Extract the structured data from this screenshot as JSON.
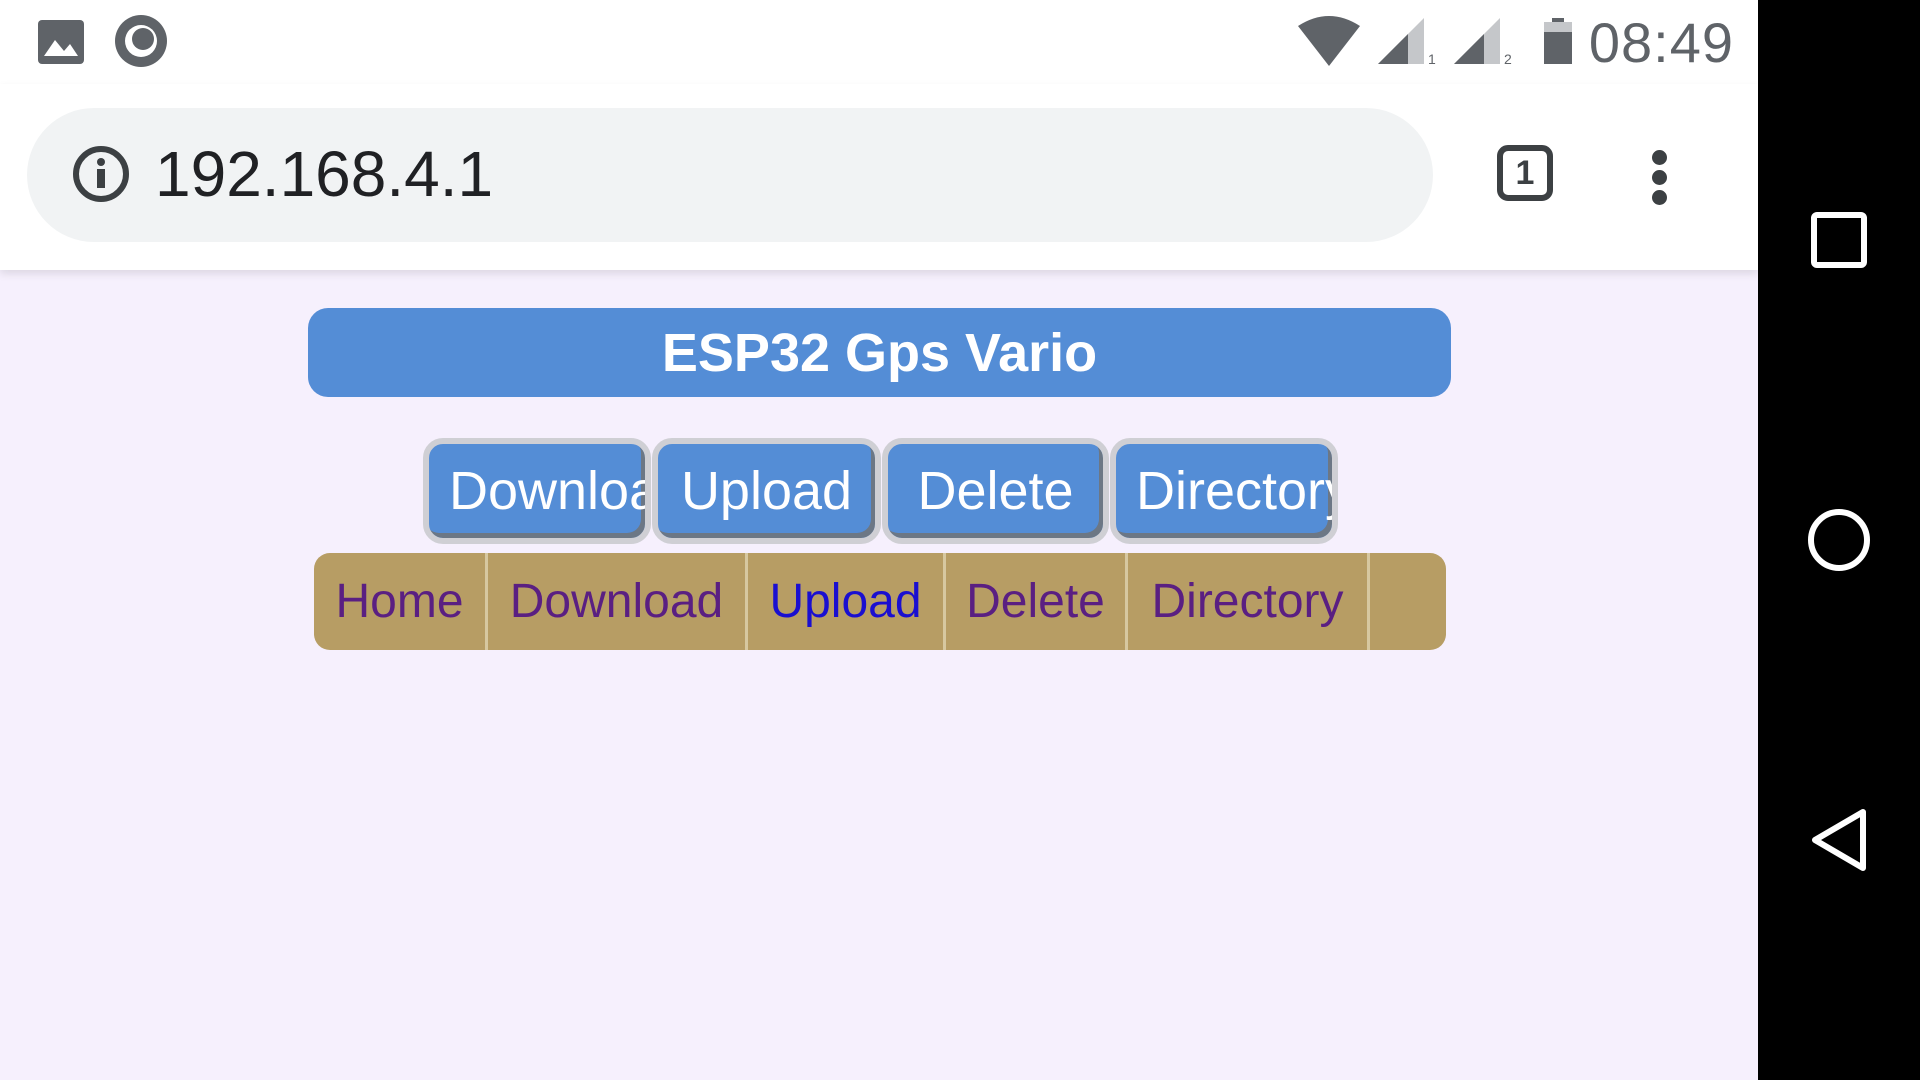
{
  "status_bar": {
    "time": "08:49",
    "icons": [
      "gallery-icon",
      "sync-icon",
      "wifi-icon",
      "signal-sim1-icon",
      "signal-sim2-icon",
      "battery-icon"
    ],
    "sim1_label": "1",
    "sim2_label": "2"
  },
  "browser": {
    "url": "192.168.4.1",
    "tab_count": "1",
    "icons": [
      "info-icon",
      "tabs-icon",
      "overflow-menu-icon"
    ]
  },
  "page": {
    "title": "ESP32 Gps Vario",
    "buttons": [
      "Download",
      "Upload",
      "Delete",
      "Directory"
    ],
    "nav": [
      "Home",
      "Download",
      "Upload",
      "Delete",
      "Directory"
    ],
    "active_nav": "Upload",
    "colors": {
      "background": "#f6f0fd",
      "title_bar": "#548dd6",
      "buttons": "#548dd6",
      "nav_bar": "#b79d64",
      "nav_link": "#5a1f82",
      "nav_link_active": "#1a0fd0"
    }
  },
  "android_nav": {
    "icons": [
      "recents-icon",
      "home-icon",
      "back-icon"
    ]
  }
}
